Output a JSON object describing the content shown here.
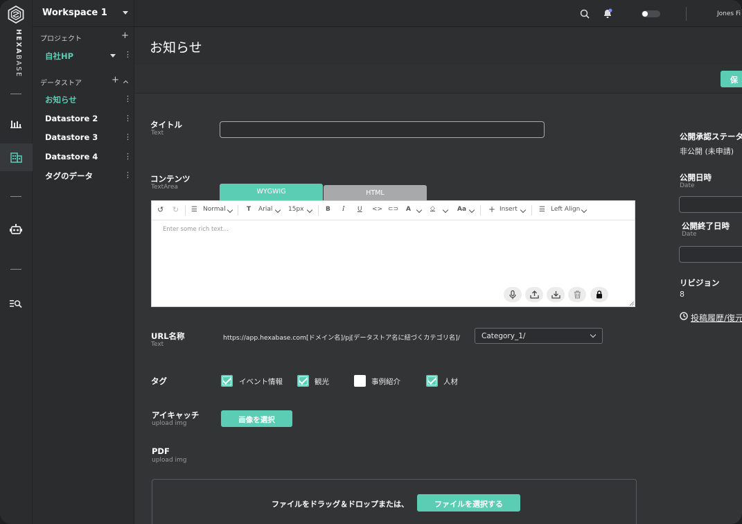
{
  "brand": {
    "part1": "HEXA",
    "part2": "BASE"
  },
  "workspace": {
    "title": "Workspace 1"
  },
  "sidebar": {
    "project_header": "プロジェクト",
    "projects": [
      {
        "label": "自社HP"
      }
    ],
    "datastore_header": "データストア",
    "datastores": [
      {
        "label": "お知らせ"
      },
      {
        "label": "Datastore 2"
      },
      {
        "label": "Datastore 3"
      },
      {
        "label": "Datastore 4"
      },
      {
        "label": "タグのデータ"
      }
    ]
  },
  "topbar": {
    "user": "Jones Fi"
  },
  "page": {
    "title": "お知らせ",
    "save_label": "保"
  },
  "form": {
    "title": {
      "label": "タイトル",
      "type": "Text",
      "value": ""
    },
    "content": {
      "label": "コンテンツ",
      "type": "TextArea",
      "tabs": [
        "WYGWIG",
        "HTML"
      ],
      "toolbar": {
        "style": "Normal",
        "font": "Arial",
        "size": "15px",
        "case": "Aa",
        "insert": "Insert",
        "align": "Left Align"
      },
      "placeholder": "Enter some rich text..."
    },
    "url": {
      "label": "URL名称",
      "type": "Text",
      "prefix": "https://app.hexabase.com[ドメイン名]/pj[データストア名に紐づくカテゴリ名]/",
      "selected": "Category_1/"
    },
    "tags": {
      "label": "タグ",
      "options": [
        {
          "label": "イベント情報",
          "checked": true
        },
        {
          "label": "観光",
          "checked": true
        },
        {
          "label": "事例紹介",
          "checked": false
        },
        {
          "label": "人材",
          "checked": true
        }
      ]
    },
    "eyecatch": {
      "label": "アイキャッチ",
      "type": "upload img",
      "button": "画像を選択"
    },
    "pdf": {
      "label": "PDF",
      "type": "upload img",
      "drop_text": "ファイルをドラッグ＆ドロップまたは、",
      "button": "ファイルを選択する"
    }
  },
  "right_panel": {
    "status_label": "公開承認ステータ",
    "status_value": "非公開 (未申請)",
    "publish_date_label": "公開日時",
    "publish_date_type": "Date",
    "end_date_label": "公開終了日時",
    "end_date_type": "Date",
    "revision_label": "リビジョン",
    "revision_value": "8",
    "history_link": "投稿履歴/復元"
  },
  "colors": {
    "accent": "#5ccdb5",
    "background": "#333436",
    "sidebar": "#2b2c2e"
  }
}
